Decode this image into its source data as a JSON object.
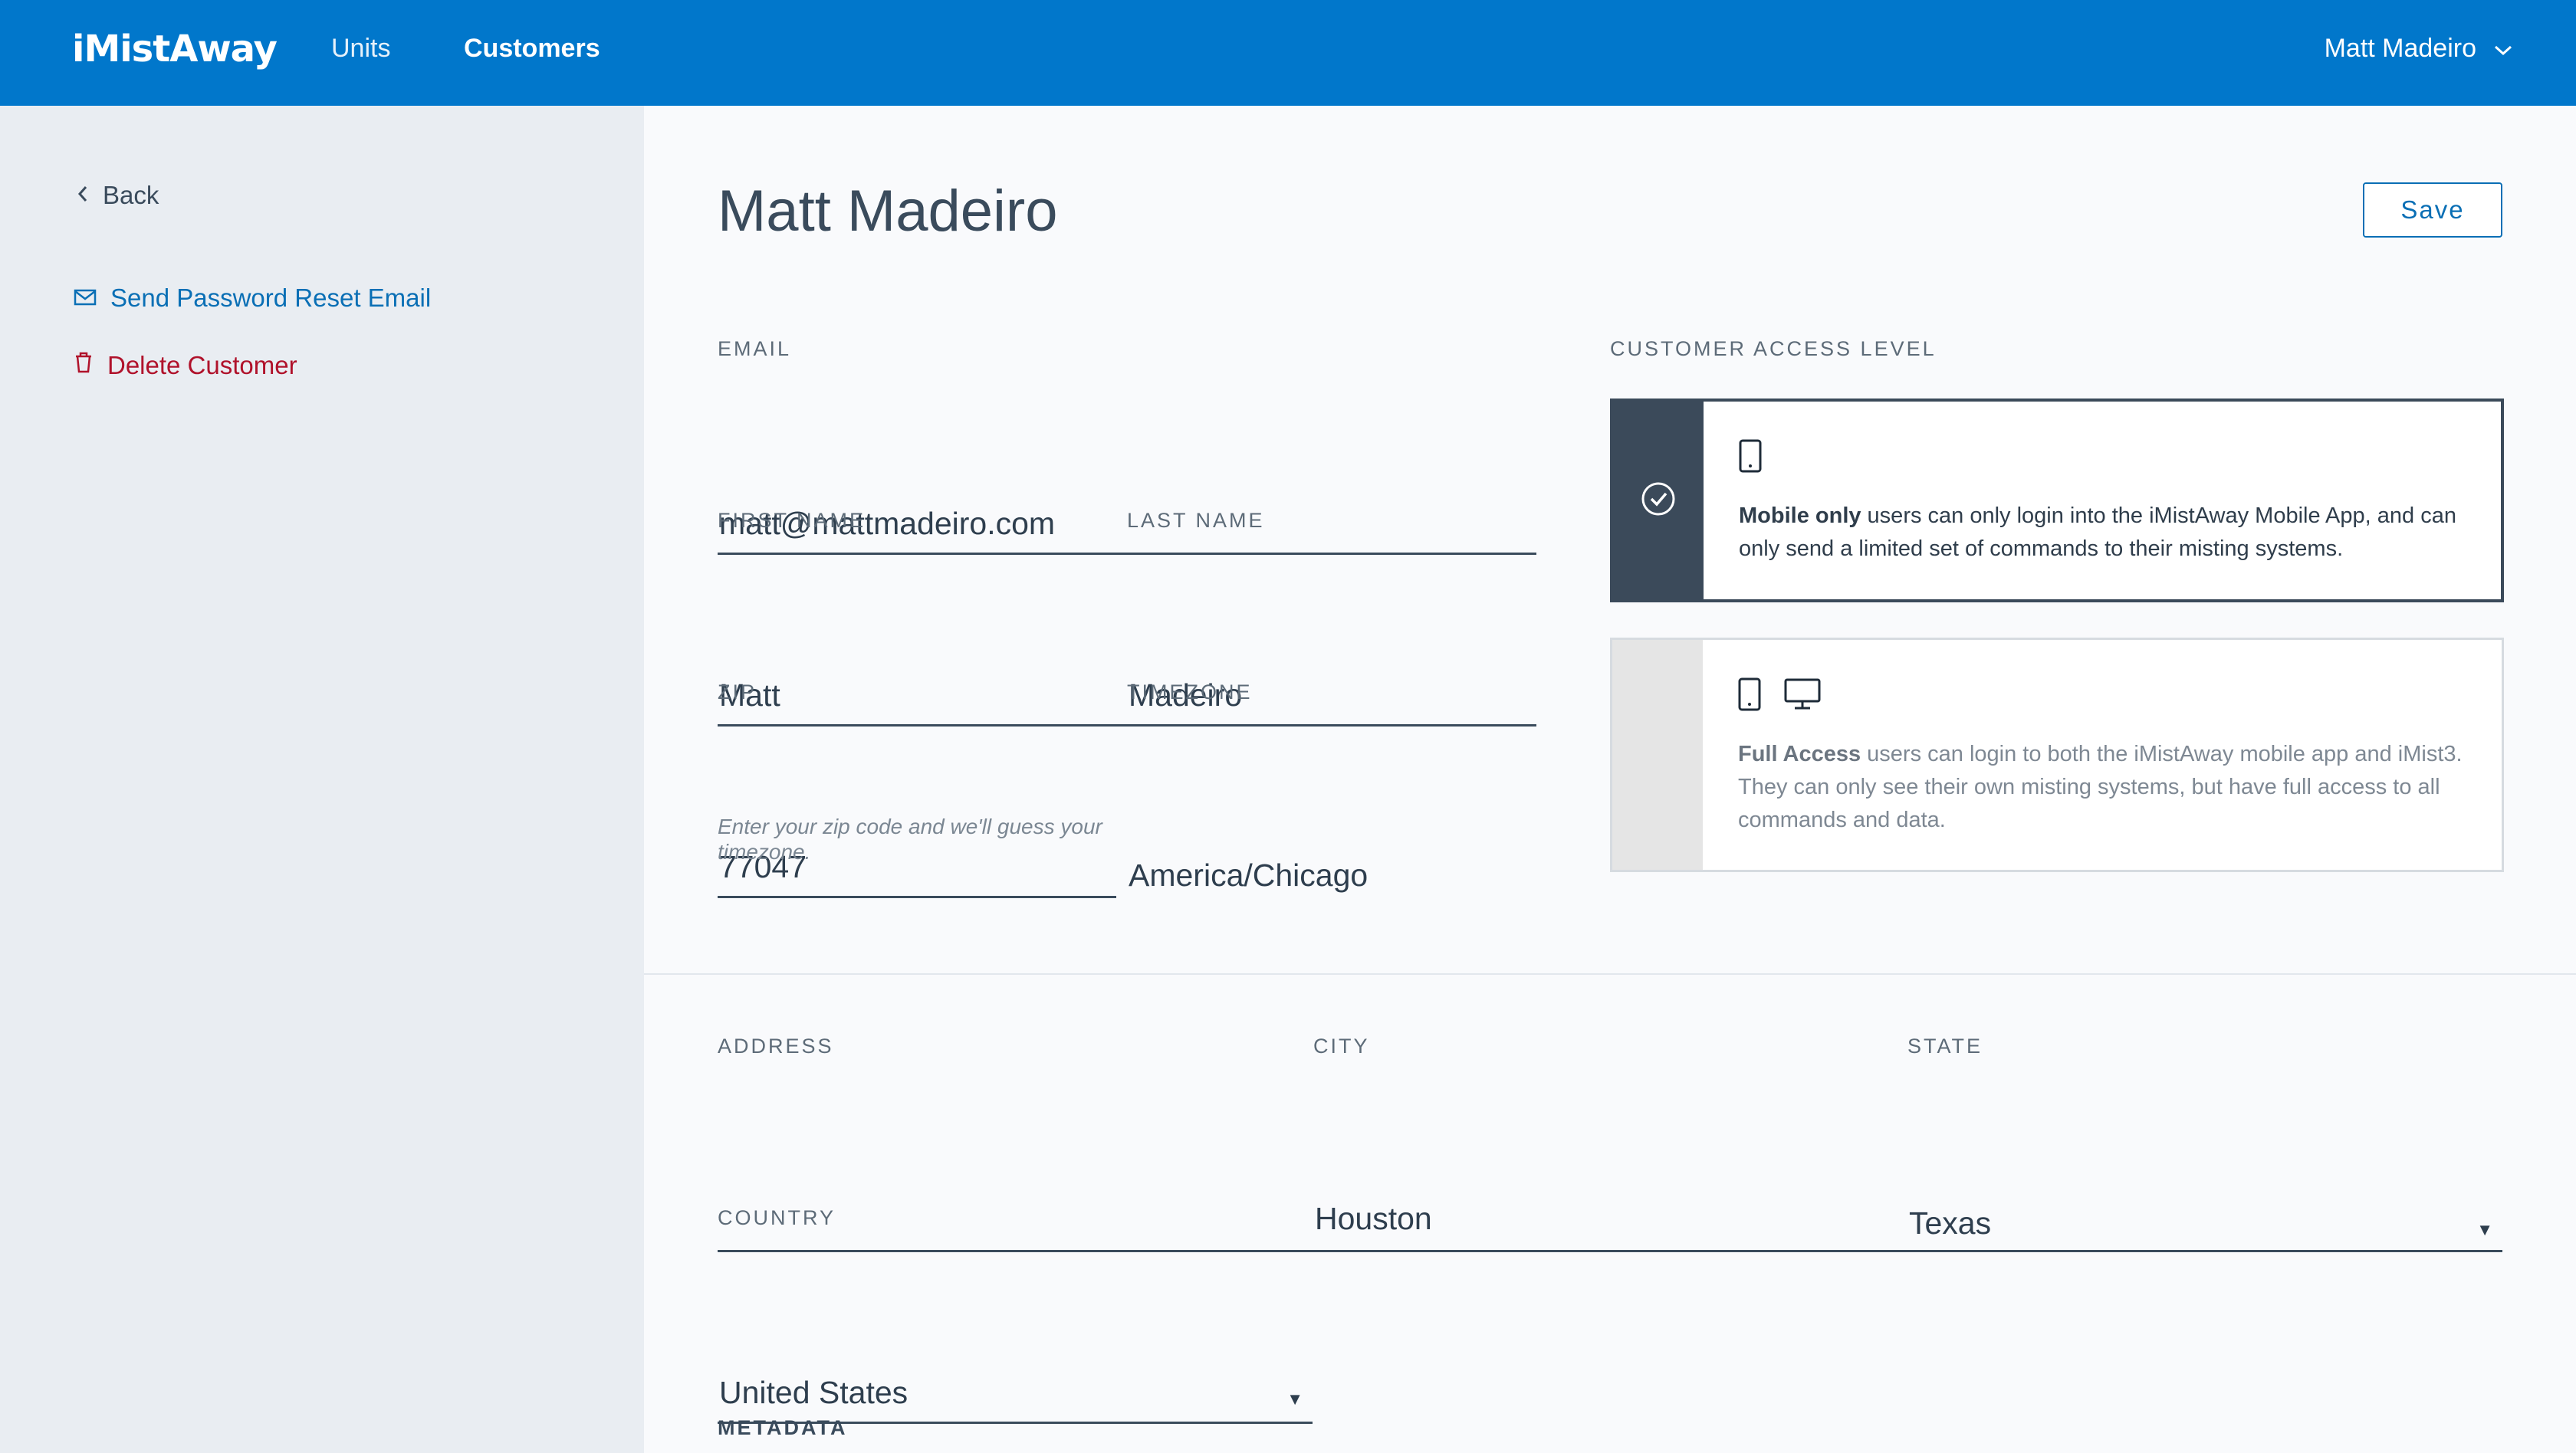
{
  "app": {
    "logo": "iMistAway"
  },
  "nav": {
    "items": [
      {
        "label": "Units"
      },
      {
        "label": "Customers"
      }
    ],
    "user": "Matt Madeiro"
  },
  "sidebar": {
    "back": "Back",
    "reset_email": "Send Password Reset Email",
    "delete_customer": "Delete Customer"
  },
  "page": {
    "title": "Matt Madeiro",
    "save_label": "Save"
  },
  "form": {
    "email_label": "EMAIL",
    "email_value": "matt@mattmadeiro.com",
    "first_name_label": "FIRST NAME",
    "first_name_value": "Matt",
    "last_name_label": "LAST NAME",
    "last_name_value": "Madeiro",
    "zip_label": "ZIP",
    "zip_value": "77047",
    "zip_hint": "Enter your zip code and we'll guess your timezone.",
    "timezone_label": "TIMEZONE",
    "timezone_value": "America/Chicago",
    "address_label": "ADDRESS",
    "address_value": "",
    "city_label": "CITY",
    "city_value": "Houston",
    "state_label": "STATE",
    "state_value": "Texas",
    "country_label": "COUNTRY",
    "country_value": "United States",
    "metadata_label": "METADATA"
  },
  "access": {
    "label": "CUSTOMER ACCESS LEVEL",
    "options": [
      {
        "title": "Mobile only",
        "description": " users can only login into the iMistAway Mobile App, and can only send a limited set of commands to their misting systems.",
        "selected": true,
        "icons": [
          "tablet-icon"
        ]
      },
      {
        "title": "Full Access",
        "description": " users can login to both the iMistAway mobile app and iMist3. They can only see their own misting systems, but have full access to all commands and data.",
        "selected": false,
        "icons": [
          "tablet-icon",
          "monitor-icon"
        ]
      }
    ]
  },
  "colors": {
    "brand": "#0177cb",
    "link": "#0a6fb5",
    "danger": "#b0122b",
    "dark": "#3b4a5a"
  }
}
